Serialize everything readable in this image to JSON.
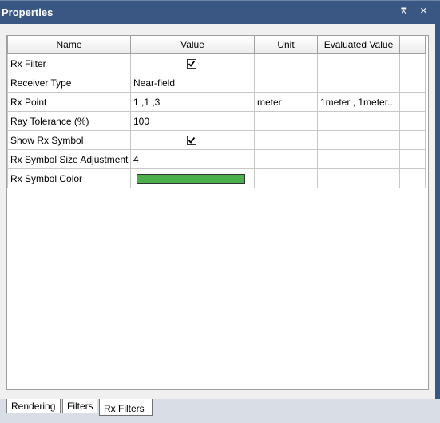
{
  "window": {
    "title": "Properties",
    "pin_glyph": "⩞",
    "close_glyph": "×"
  },
  "table": {
    "headers": [
      "Name",
      "Value",
      "Unit",
      "Evaluated Value"
    ],
    "rows": [
      {
        "name": "Rx Filter",
        "value": "",
        "unit": "",
        "evaluated": "",
        "checked": true
      },
      {
        "name": "Receiver Type",
        "value": "Near-field",
        "unit": "",
        "evaluated": ""
      },
      {
        "name": "Rx Point",
        "value": "1 ,1 ,3",
        "unit": "meter",
        "evaluated": "1meter , 1meter..."
      },
      {
        "name": "Ray Tolerance (%)",
        "value": "100",
        "unit": "",
        "evaluated": ""
      },
      {
        "name": "Show Rx Symbol",
        "value": "",
        "unit": "",
        "evaluated": "",
        "checked": true
      },
      {
        "name": "Rx Symbol Size Adjustment",
        "value": "4",
        "unit": "",
        "evaluated": ""
      },
      {
        "name": "Rx Symbol Color",
        "value": "",
        "unit": "",
        "evaluated": "",
        "color": "#4bb04b"
      }
    ]
  },
  "tabs": [
    {
      "label": "Rendering"
    },
    {
      "label": "Filters"
    },
    {
      "label": "Rx Filters",
      "active": true
    }
  ],
  "colors": {
    "title_bar": "#3a5683",
    "panel": "#f0f0f0",
    "swatch_green": "#4bb04b"
  }
}
